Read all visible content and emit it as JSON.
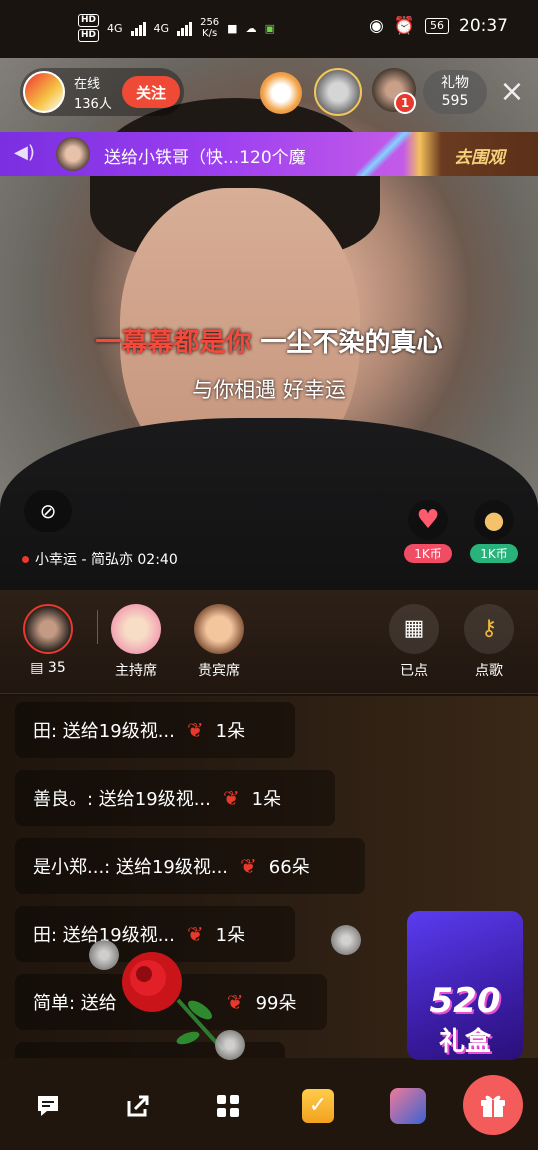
{
  "status_bar": {
    "hd1": "HD",
    "hd2": "HD",
    "net1": "4G",
    "net2": "4G",
    "speed_value": "256",
    "speed_unit": "K/s",
    "battery": "56",
    "time": "20:37"
  },
  "header": {
    "online_label": "在线",
    "online_count": "136人",
    "follow_label": "关注",
    "viewer_badge": "1",
    "gift_label": "礼物",
    "gift_count": "595",
    "close_icon": "×"
  },
  "banner": {
    "text": "送给小铁哥（快...120个魔",
    "action": "去围观"
  },
  "lyrics": {
    "line1_sung": "一幕幕都是你",
    "line1_rest": " 一尘不染的真心",
    "line2": "与你相遇 好幸运"
  },
  "video_controls": {
    "now_playing": "小幸运 - 简弘亦 02:40",
    "heart_price": "1K币",
    "egg_price": "1K币"
  },
  "seats": {
    "gift_count": "35",
    "host_seat": "主持席",
    "vip_seat": "贵宾席",
    "ordered_label": "已点",
    "order_song_label": "点歌"
  },
  "chat": {
    "messages": [
      {
        "user": "田: 送给19级视...",
        "count": "1朵"
      },
      {
        "user": "善良。: 送给19级视...",
        "count": "1朵"
      },
      {
        "user": "是小郑...: 送给19级视...",
        "count": "66朵"
      },
      {
        "user": "田: 送给19级视...",
        "count": "1朵"
      },
      {
        "user": "简单: 送给",
        "count": "99朵"
      }
    ]
  },
  "promo": {
    "big": "520",
    "small": "礼盒"
  },
  "icons": [
    "chat-icon",
    "share-icon",
    "apps-icon",
    "task-icon",
    "avatar-icon",
    "gift-icon",
    "camera-off-icon",
    "key-icon",
    "ticket-icon",
    "rose-icon",
    "heart-icon",
    "egg-icon"
  ],
  "colors": {
    "accent_red": "#ee4a36",
    "lyric_highlight": "#f24a3c",
    "banner_purple": "#9c3ff0",
    "promo_purple": "#5a3cf0"
  }
}
